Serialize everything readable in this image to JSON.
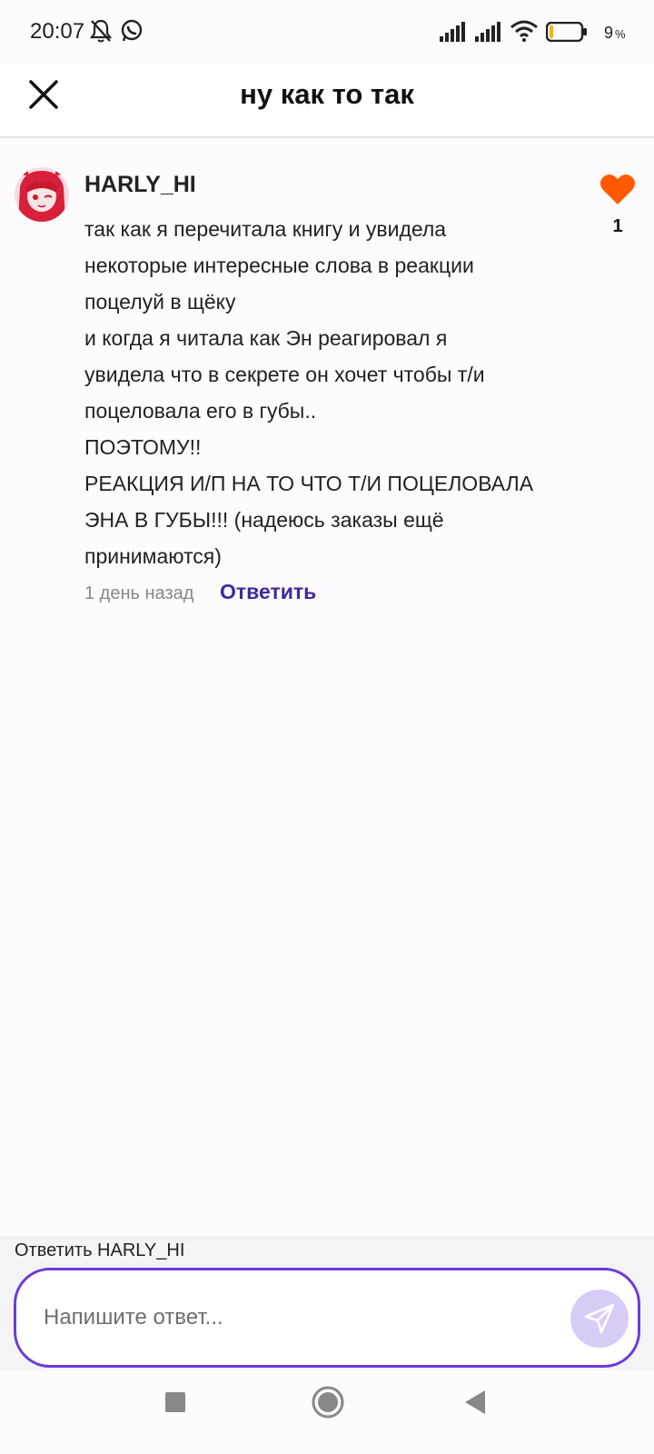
{
  "status_bar": {
    "time": "20:07",
    "battery_percent": "9",
    "icons": [
      "bell-muted-icon",
      "whatsapp-icon",
      "signal-icon",
      "signal-icon",
      "wifi-icon",
      "battery-icon"
    ]
  },
  "header": {
    "title": "ну как то так",
    "close_icon": "close-icon"
  },
  "comment": {
    "author": "HARLY_HI",
    "text": "так как я перечитала книгу и увидела\nнекоторые интересные слова в реакции\nпоцелуй в щёку\nи когда я читала как Эн реагировал я\nувидела что в секрете он хочет чтобы т/и\nпоцеловала его в губы..\nПОЭТОМУ!!\nРЕАКЦИЯ И/П НА ТО ЧТО Т/И ПОЦЕЛОВАЛА\nЭНА В ГУБЫ!!! (надеюсь заказы ещё\nпринимаются)",
    "likes": "1",
    "time_ago": "1 день назад",
    "reply_label": "Ответить",
    "like_color": "#ff5a00"
  },
  "reply_box": {
    "reply_to": "Ответить HARLY_HI",
    "placeholder": "Напишите ответ...",
    "accent_color": "#6a3bdc"
  },
  "nav": {
    "icons": [
      "recents-icon",
      "home-icon",
      "back-icon"
    ]
  }
}
